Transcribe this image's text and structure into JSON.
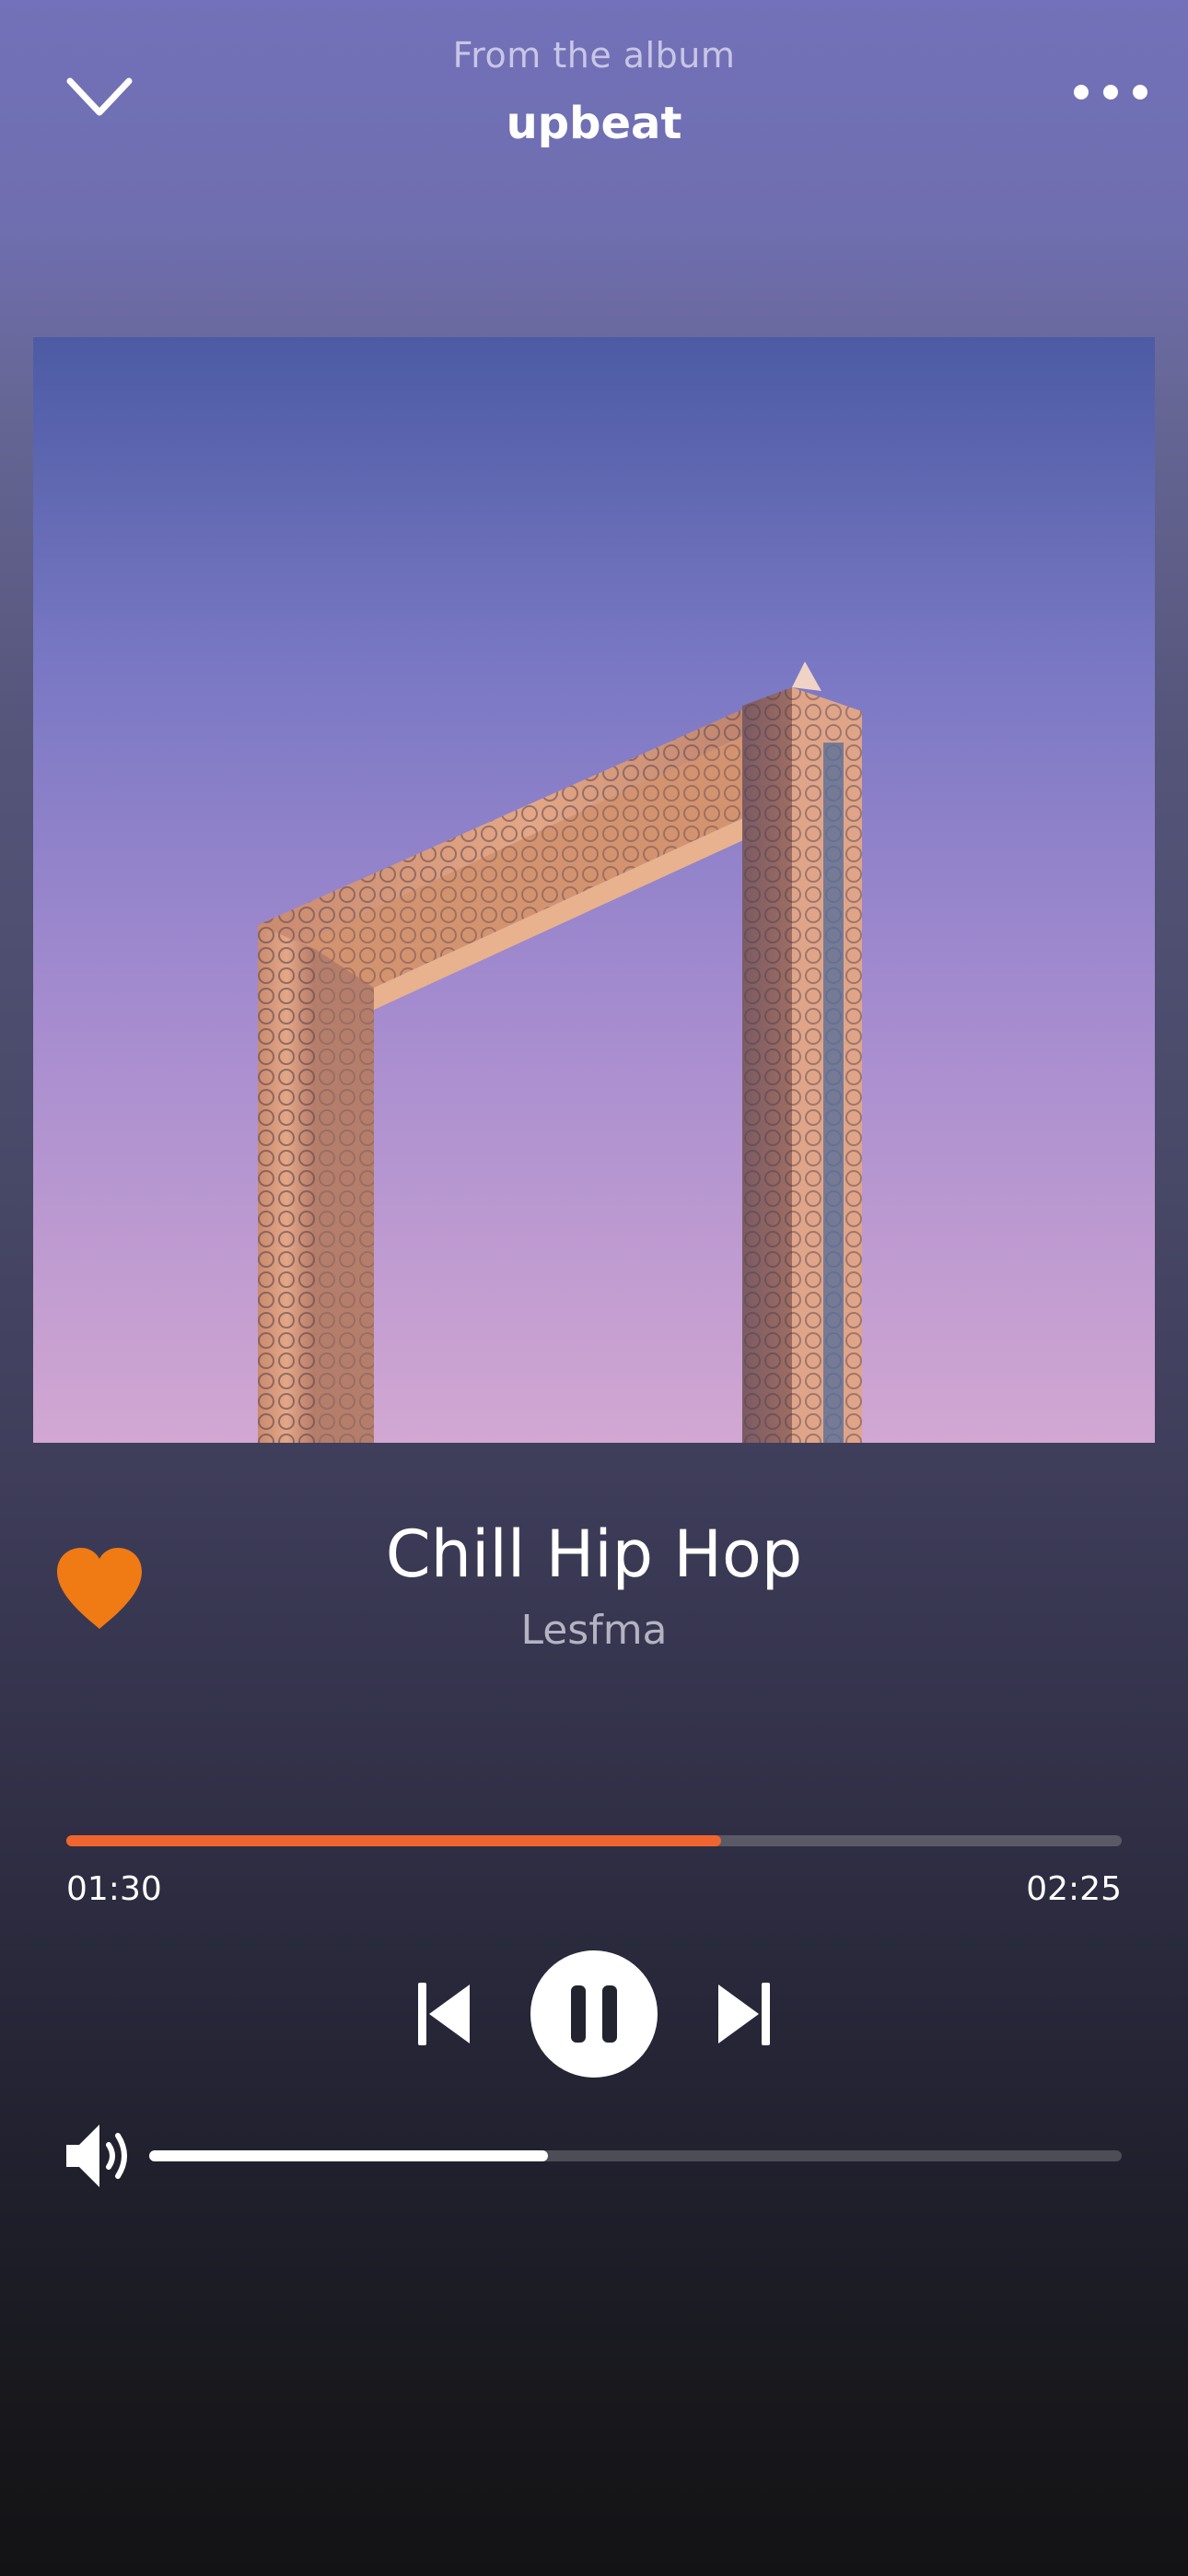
{
  "header": {
    "subtitle": "From the album",
    "album": "upbeat",
    "back_icon": "chevron-down-icon",
    "more_icon": "more-horizontal-icon"
  },
  "artwork": {
    "description_icon": "album-artwork"
  },
  "track": {
    "title": "Chill Hip Hop",
    "artist": "Lesfma",
    "favorited": true,
    "favorite_icon": "heart-icon"
  },
  "playback": {
    "elapsed": "01:30",
    "total": "02:25",
    "progress": 0.62,
    "state": "playing"
  },
  "controls": {
    "previous_icon": "skip-previous-icon",
    "pause_icon": "pause-icon",
    "next_icon": "skip-next-icon"
  },
  "volume": {
    "level": 0.41,
    "icon": "volume-icon"
  },
  "colors": {
    "accent": "#f0652f",
    "favorite": "#f07a14",
    "background_top": "#7271b9",
    "background_bottom": "#131315"
  }
}
